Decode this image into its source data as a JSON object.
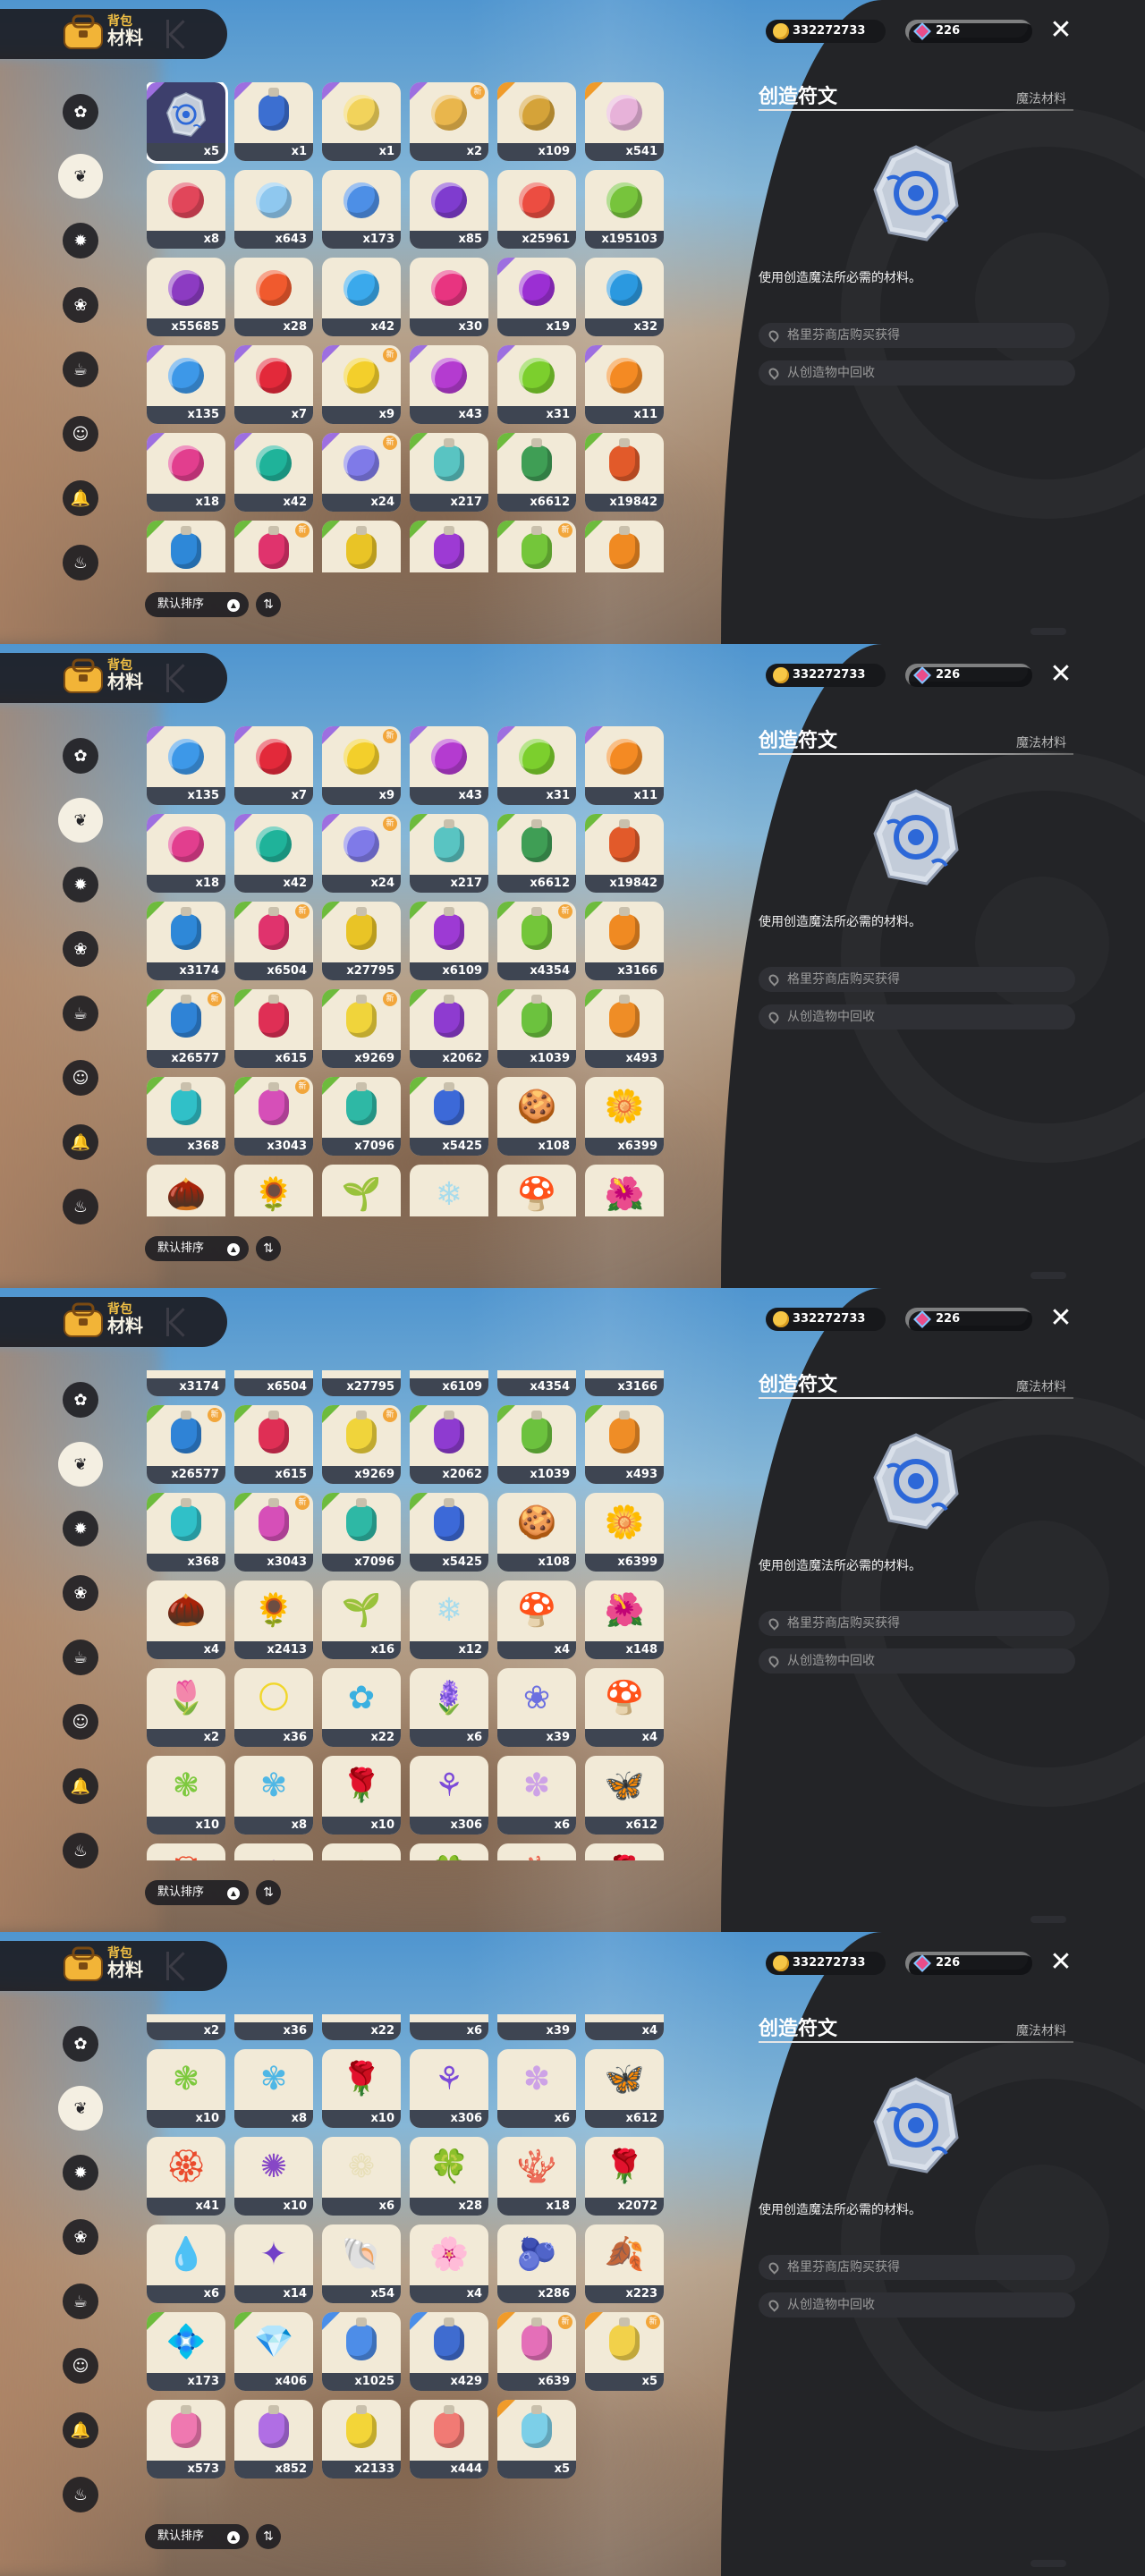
{
  "header": {
    "subtitle": "背包",
    "title": "材料"
  },
  "currency": {
    "coins": "332272733",
    "gems": "226"
  },
  "sort": {
    "label": "默认排序"
  },
  "detail": {
    "name": "创造符文",
    "category": "魔法材料",
    "description": "使用创造魔法所必需的材料。",
    "sources": [
      "格里芬商店购买获得",
      "从创造物中回收"
    ]
  },
  "sidebar_icons": [
    "clover-badge-icon",
    "leaf-icon",
    "gear-flower-icon",
    "flower-badge-icon",
    "cup-icon",
    "face-icon",
    "bell-icon",
    "cake-icon"
  ],
  "active_sidebar_index": 1,
  "items": [
    {
      "id": 1,
      "count": "x5",
      "kind": "rune",
      "color": "#8fa6e0",
      "rarity": "purple",
      "selected": true
    },
    {
      "id": 2,
      "count": "x1",
      "kind": "potion",
      "color": "#3c6fd1",
      "rarity": "purple"
    },
    {
      "id": 3,
      "count": "x1",
      "kind": "gem",
      "color": "#f2d35b",
      "rarity": "purple"
    },
    {
      "id": 4,
      "count": "x2",
      "kind": "gem",
      "color": "#e9b64c",
      "rarity": "purple",
      "new": true
    },
    {
      "id": 5,
      "count": "x109",
      "kind": "gem",
      "color": "#d5a339",
      "rarity": "orange"
    },
    {
      "id": 6,
      "count": "x541",
      "kind": "gem",
      "color": "#e7b2d9",
      "rarity": "orange"
    },
    {
      "id": 7,
      "count": "x8",
      "kind": "gem",
      "color": "#e1465a",
      "rarity": "none"
    },
    {
      "id": 8,
      "count": "x643",
      "kind": "gem",
      "color": "#8fc8ef",
      "rarity": "none"
    },
    {
      "id": 9,
      "count": "x173",
      "kind": "gem",
      "color": "#4d8fe6",
      "rarity": "none"
    },
    {
      "id": 10,
      "count": "x85",
      "kind": "gem",
      "color": "#7f3ccf",
      "rarity": "none"
    },
    {
      "id": 11,
      "count": "x25961",
      "kind": "gem",
      "color": "#ec4d41",
      "rarity": "none"
    },
    {
      "id": 12,
      "count": "x195103",
      "kind": "gem",
      "color": "#77c43c",
      "rarity": "none"
    },
    {
      "id": 13,
      "count": "x55685",
      "kind": "gem",
      "color": "#8c3bc2",
      "rarity": "none"
    },
    {
      "id": 14,
      "count": "x28",
      "kind": "gem",
      "color": "#f05a2e",
      "rarity": "none"
    },
    {
      "id": 15,
      "count": "x42",
      "kind": "gem",
      "color": "#3aa9ec",
      "rarity": "none"
    },
    {
      "id": 16,
      "count": "x30",
      "kind": "gem",
      "color": "#e83480",
      "rarity": "none"
    },
    {
      "id": 17,
      "count": "x19",
      "kind": "gem",
      "color": "#9b2fd3",
      "rarity": "purple"
    },
    {
      "id": 18,
      "count": "x32",
      "kind": "gem",
      "color": "#2b99e0",
      "rarity": "none"
    },
    {
      "id": 19,
      "count": "x135",
      "kind": "gem",
      "color": "#3d98e8",
      "rarity": "purple"
    },
    {
      "id": 20,
      "count": "x7",
      "kind": "gem",
      "color": "#e3293a",
      "rarity": "purple"
    },
    {
      "id": 21,
      "count": "x9",
      "kind": "gem",
      "color": "#f3cf2b",
      "rarity": "purple",
      "new": true
    },
    {
      "id": 22,
      "count": "x43",
      "kind": "gem",
      "color": "#b43bd0",
      "rarity": "purple"
    },
    {
      "id": 23,
      "count": "x31",
      "kind": "gem",
      "color": "#7ccf2d",
      "rarity": "purple"
    },
    {
      "id": 24,
      "count": "x11",
      "kind": "gem",
      "color": "#f48a23",
      "rarity": "purple"
    },
    {
      "id": 25,
      "count": "x18",
      "kind": "gem",
      "color": "#e23e8e",
      "rarity": "purple"
    },
    {
      "id": 26,
      "count": "x42",
      "kind": "gem",
      "color": "#1fb39a",
      "rarity": "purple"
    },
    {
      "id": 27,
      "count": "x24",
      "kind": "gem",
      "color": "#7f7ae8",
      "rarity": "purple",
      "new": true
    },
    {
      "id": 28,
      "count": "x217",
      "kind": "potion",
      "color": "#59c4c2",
      "rarity": "green"
    },
    {
      "id": 29,
      "count": "x6612",
      "kind": "potion",
      "color": "#3f9e55",
      "rarity": "green"
    },
    {
      "id": 30,
      "count": "x19842",
      "kind": "potion",
      "color": "#e25a2a",
      "rarity": "green"
    },
    {
      "id": 31,
      "count": "x3174",
      "kind": "potion",
      "color": "#2e88d8",
      "rarity": "green"
    },
    {
      "id": 32,
      "count": "x6504",
      "kind": "potion",
      "color": "#e0336d",
      "rarity": "green",
      "new": true
    },
    {
      "id": 33,
      "count": "x27795",
      "kind": "potion",
      "color": "#e9c426",
      "rarity": "green"
    },
    {
      "id": 34,
      "count": "x6109",
      "kind": "potion",
      "color": "#9d3ad4",
      "rarity": "green"
    },
    {
      "id": 35,
      "count": "x4354",
      "kind": "potion",
      "color": "#74c63a",
      "rarity": "green",
      "new": true
    },
    {
      "id": 36,
      "count": "x3166",
      "kind": "potion",
      "color": "#f08a22",
      "rarity": "green"
    },
    {
      "id": 37,
      "count": "x26577",
      "kind": "potion",
      "color": "#2f83d6",
      "rarity": "green",
      "new": true
    },
    {
      "id": 38,
      "count": "x615",
      "kind": "potion",
      "color": "#df2f55",
      "rarity": "green"
    },
    {
      "id": 39,
      "count": "x9269",
      "kind": "potion",
      "color": "#f0d43b",
      "rarity": "green",
      "new": true
    },
    {
      "id": 40,
      "count": "x2062",
      "kind": "potion",
      "color": "#8e3bd0",
      "rarity": "green"
    },
    {
      "id": 41,
      "count": "x1039",
      "kind": "potion",
      "color": "#6cc23e",
      "rarity": "green"
    },
    {
      "id": 42,
      "count": "x493",
      "kind": "potion",
      "color": "#ef8d26",
      "rarity": "green"
    },
    {
      "id": 43,
      "count": "x368",
      "kind": "potion",
      "color": "#30c0c8",
      "rarity": "green"
    },
    {
      "id": 44,
      "count": "x3043",
      "kind": "potion",
      "color": "#d64fb8",
      "rarity": "green",
      "new": true
    },
    {
      "id": 45,
      "count": "x7096",
      "kind": "potion",
      "color": "#2eb8a5",
      "rarity": "green"
    },
    {
      "id": 46,
      "count": "x5425",
      "kind": "potion",
      "color": "#3c69d8",
      "rarity": "green"
    },
    {
      "id": 47,
      "count": "x108",
      "kind": "emoji",
      "glyph": "🍪",
      "color": "#d18b3a",
      "rarity": "none"
    },
    {
      "id": 48,
      "count": "x6399",
      "kind": "emoji",
      "glyph": "🌼",
      "color": "#f2d22f",
      "rarity": "none"
    },
    {
      "id": 49,
      "count": "x4",
      "kind": "emoji",
      "glyph": "🌰",
      "color": "#5c8a3e",
      "rarity": "none"
    },
    {
      "id": 50,
      "count": "x2413",
      "kind": "emoji",
      "glyph": "🌻",
      "color": "#f0b530",
      "rarity": "none"
    },
    {
      "id": 51,
      "count": "x16",
      "kind": "emoji",
      "glyph": "🌱",
      "color": "#8ed4d6",
      "rarity": "none"
    },
    {
      "id": 52,
      "count": "x12",
      "kind": "emoji",
      "glyph": "❄",
      "color": "#a8dcec",
      "rarity": "none"
    },
    {
      "id": 53,
      "count": "x4",
      "kind": "emoji",
      "glyph": "🍄",
      "color": "#ef9b3b",
      "rarity": "none"
    },
    {
      "id": 54,
      "count": "x148",
      "kind": "emoji",
      "glyph": "🌺",
      "color": "#f28a8a",
      "rarity": "none"
    },
    {
      "id": 55,
      "count": "x2",
      "kind": "emoji",
      "glyph": "🌷",
      "color": "#f0b07a",
      "rarity": "none"
    },
    {
      "id": 56,
      "count": "x36",
      "kind": "emoji",
      "glyph": "🌕",
      "color": "#f1d72b",
      "rarity": "none"
    },
    {
      "id": 57,
      "count": "x22",
      "kind": "emoji",
      "glyph": "✿",
      "color": "#3ab0e0",
      "rarity": "none"
    },
    {
      "id": 58,
      "count": "x6",
      "kind": "emoji",
      "glyph": "🪻",
      "color": "#8a5ad6",
      "rarity": "none"
    },
    {
      "id": 59,
      "count": "x39",
      "kind": "emoji",
      "glyph": "❀",
      "color": "#6b6fe0",
      "rarity": "none"
    },
    {
      "id": 60,
      "count": "x4",
      "kind": "emoji",
      "glyph": "🍄",
      "color": "#3e79d8",
      "rarity": "none"
    },
    {
      "id": 61,
      "count": "x10",
      "kind": "emoji",
      "glyph": "❃",
      "color": "#7dc93e",
      "rarity": "none"
    },
    {
      "id": 62,
      "count": "x8",
      "kind": "emoji",
      "glyph": "✾",
      "color": "#4fb7e5",
      "rarity": "none"
    },
    {
      "id": 63,
      "count": "x10",
      "kind": "emoji",
      "glyph": "🌹",
      "color": "#e0403d",
      "rarity": "none"
    },
    {
      "id": 64,
      "count": "x306",
      "kind": "emoji",
      "glyph": "⚘",
      "color": "#7c4ad8",
      "rarity": "none"
    },
    {
      "id": 65,
      "count": "x6",
      "kind": "emoji",
      "glyph": "✽",
      "color": "#cda2e6",
      "rarity": "none"
    },
    {
      "id": 66,
      "count": "x612",
      "kind": "emoji",
      "glyph": "🦋",
      "color": "#d8365c",
      "rarity": "none"
    },
    {
      "id": 67,
      "count": "x41",
      "kind": "emoji",
      "glyph": "🏵",
      "color": "#ea4b2c",
      "rarity": "none"
    },
    {
      "id": 68,
      "count": "x10",
      "kind": "emoji",
      "glyph": "✺",
      "color": "#8747c6",
      "rarity": "none"
    },
    {
      "id": 69,
      "count": "x6",
      "kind": "emoji",
      "glyph": "❁",
      "color": "#e8dfb8",
      "rarity": "none"
    },
    {
      "id": 70,
      "count": "x28",
      "kind": "emoji",
      "glyph": "🍀",
      "color": "#3c9a43",
      "rarity": "none"
    },
    {
      "id": 71,
      "count": "x18",
      "kind": "emoji",
      "glyph": "🪸",
      "color": "#2e7ed2",
      "rarity": "none"
    },
    {
      "id": 72,
      "count": "x2072",
      "kind": "emoji",
      "glyph": "🌹",
      "color": "#d12f37",
      "rarity": "none"
    },
    {
      "id": 73,
      "count": "x6",
      "kind": "emoji",
      "glyph": "💧",
      "color": "#3db3e9",
      "rarity": "none"
    },
    {
      "id": 74,
      "count": "x14",
      "kind": "emoji",
      "glyph": "✦",
      "color": "#7240c8",
      "rarity": "none"
    },
    {
      "id": 75,
      "count": "x54",
      "kind": "emoji",
      "glyph": "🐚",
      "color": "#f1d37a",
      "rarity": "none"
    },
    {
      "id": 76,
      "count": "x4",
      "kind": "emoji",
      "glyph": "🌸",
      "color": "#ec7464",
      "rarity": "none"
    },
    {
      "id": 77,
      "count": "x286",
      "kind": "emoji",
      "glyph": "🫐",
      "color": "#2f57c7",
      "rarity": "none"
    },
    {
      "id": 78,
      "count": "x223",
      "kind": "emoji",
      "glyph": "🍂",
      "color": "#f0ac27",
      "rarity": "none"
    },
    {
      "id": 79,
      "count": "x173",
      "kind": "emoji",
      "glyph": "💠",
      "color": "#36b9e6",
      "rarity": "green"
    },
    {
      "id": 80,
      "count": "x406",
      "kind": "emoji",
      "glyph": "💎",
      "color": "#b65fe0",
      "rarity": "green"
    },
    {
      "id": 81,
      "count": "x1025",
      "kind": "potion",
      "color": "#4d8de8",
      "rarity": "blue"
    },
    {
      "id": 82,
      "count": "x429",
      "kind": "potion",
      "color": "#3f6cd0",
      "rarity": "blue"
    },
    {
      "id": 83,
      "count": "x639",
      "kind": "potion",
      "color": "#e46fb8",
      "rarity": "orange",
      "new": true
    },
    {
      "id": 84,
      "count": "x5",
      "kind": "potion",
      "color": "#f2d14a",
      "rarity": "orange",
      "new": true
    },
    {
      "id": 85,
      "count": "x573",
      "kind": "potion",
      "color": "#ef78b0",
      "rarity": "none"
    },
    {
      "id": 86,
      "count": "x852",
      "kind": "potion",
      "color": "#b06ee4",
      "rarity": "none"
    },
    {
      "id": 87,
      "count": "x2133",
      "kind": "potion",
      "color": "#f3d538",
      "rarity": "none"
    },
    {
      "id": 88,
      "count": "x444",
      "kind": "potion",
      "color": "#f17a74",
      "rarity": "none"
    },
    {
      "id": 89,
      "count": "x5",
      "kind": "potion",
      "color": "#7ccfe8",
      "rarity": "orange"
    }
  ],
  "views": [
    {
      "scroll_rows": 0
    },
    {
      "scroll_rows": 3
    },
    {
      "scroll_rows": 5.6
    },
    {
      "scroll_rows": 9.6
    }
  ]
}
